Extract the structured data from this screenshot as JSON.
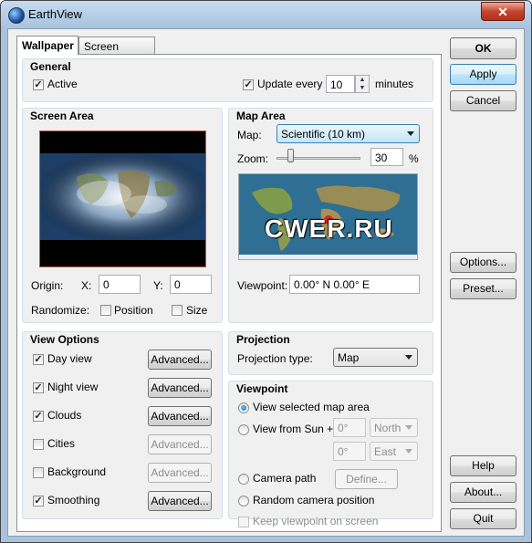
{
  "window": {
    "title": "EarthView",
    "close_glyph": "✕"
  },
  "tabs": [
    {
      "label": "Wallpaper",
      "active": true
    },
    {
      "label": "Screen Saver",
      "active": false
    }
  ],
  "general": {
    "title": "General",
    "active_label": "Active",
    "active_checked": true,
    "update_label": "Update every",
    "update_checked": true,
    "update_value": "10",
    "update_unit": "minutes"
  },
  "screen_area": {
    "title": "Screen Area",
    "origin_label": "Origin:",
    "x_label": "X:",
    "x_value": "0",
    "y_label": "Y:",
    "y_value": "0",
    "randomize_label": "Randomize:",
    "position_label": "Position",
    "position_checked": false,
    "size_label": "Size",
    "size_checked": false
  },
  "map_area": {
    "title": "Map Area",
    "map_label": "Map:",
    "map_value": "Scientific (10 km)",
    "zoom_label": "Zoom:",
    "zoom_value": "30",
    "zoom_unit": "%",
    "watermark": "CWER.RU",
    "viewpoint_label": "Viewpoint:",
    "viewpoint_value": "0.00° N   0.00° E"
  },
  "view_options": {
    "title": "View Options",
    "items": [
      {
        "label": "Day view",
        "checked": true,
        "advanced": "Advanced...",
        "enabled": true
      },
      {
        "label": "Night view",
        "checked": true,
        "advanced": "Advanced...",
        "enabled": true
      },
      {
        "label": "Clouds",
        "checked": true,
        "advanced": "Advanced...",
        "enabled": true
      },
      {
        "label": "Cities",
        "checked": false,
        "advanced": "Advanced...",
        "enabled": false
      },
      {
        "label": "Background",
        "checked": false,
        "advanced": "Advanced...",
        "enabled": false
      },
      {
        "label": "Smoothing",
        "checked": true,
        "advanced": "Advanced...",
        "enabled": true
      }
    ]
  },
  "projection": {
    "title": "Projection",
    "type_label": "Projection type:",
    "type_value": "Map"
  },
  "viewpoint": {
    "title": "Viewpoint",
    "selected_label": "View selected map area",
    "sun_label": "View from Sun +",
    "lat_value": "0°",
    "lat_dir": "North",
    "lon_value": "0°",
    "lon_dir": "East",
    "camera_label": "Camera path",
    "define_label": "Define...",
    "random_label": "Random camera position",
    "keep_label": "Keep viewpoint on screen"
  },
  "buttons": {
    "ok": "OK",
    "apply": "Apply",
    "cancel": "Cancel",
    "options": "Options...",
    "preset": "Preset...",
    "help": "Help",
    "about": "About...",
    "quit": "Quit"
  }
}
